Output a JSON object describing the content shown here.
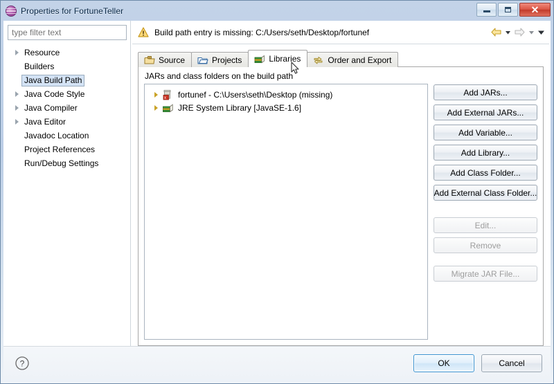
{
  "window": {
    "title": "Properties for FortuneTeller",
    "icon": "eclipse-sphere-icon",
    "controls": {
      "minimize": "minimize-button",
      "maximize": "maximize-button",
      "close": "close-button",
      "close_glyph": "✕"
    }
  },
  "sidebar": {
    "filter": {
      "placeholder": "type filter text",
      "value": ""
    },
    "items": [
      {
        "label": "Resource",
        "expandable": true,
        "selected": false
      },
      {
        "label": "Builders",
        "expandable": false,
        "selected": false
      },
      {
        "label": "Java Build Path",
        "expandable": false,
        "selected": true
      },
      {
        "label": "Java Code Style",
        "expandable": true,
        "selected": false
      },
      {
        "label": "Java Compiler",
        "expandable": true,
        "selected": false
      },
      {
        "label": "Java Editor",
        "expandable": true,
        "selected": false
      },
      {
        "label": "Javadoc Location",
        "expandable": false,
        "selected": false
      },
      {
        "label": "Project References",
        "expandable": false,
        "selected": false
      },
      {
        "label": "Run/Debug Settings",
        "expandable": false,
        "selected": false
      }
    ]
  },
  "message_bar": {
    "icon": "warning-icon",
    "text": "Build path entry is missing: C:/Users/seth/Desktop/fortunef",
    "nav": {
      "back": "back-arrow-icon",
      "back_dropdown": "chevron-down-icon",
      "forward": "forward-arrow-icon",
      "forward_dropdown": "chevron-down-icon",
      "menu_dropdown": "chevron-down-icon"
    }
  },
  "tabs": [
    {
      "label": "Source",
      "icon": "source-folder-icon",
      "active": false
    },
    {
      "label": "Projects",
      "icon": "project-folder-icon",
      "active": false
    },
    {
      "label": "Libraries",
      "icon": "library-books-icon",
      "active": true
    },
    {
      "label": "Order and Export",
      "icon": "order-export-icon",
      "active": false
    }
  ],
  "libraries_tab": {
    "caption": "JARs and class folders on the build path",
    "entries": [
      {
        "label": "fortunef - C:\\Users\\seth\\Desktop (missing)",
        "icon": "jar-error-icon",
        "expandable": true
      },
      {
        "label": "JRE System Library [JavaSE-1.6]",
        "icon": "library-books-icon",
        "expandable": true
      }
    ],
    "buttons": [
      {
        "label": "Add JARs...",
        "enabled": true
      },
      {
        "label": "Add External JARs...",
        "enabled": true
      },
      {
        "label": "Add Variable...",
        "enabled": true
      },
      {
        "label": "Add Library...",
        "enabled": true
      },
      {
        "label": "Add Class Folder...",
        "enabled": true
      },
      {
        "label": "Add External Class Folder...",
        "enabled": true
      },
      {
        "label": "Edit...",
        "enabled": false
      },
      {
        "label": "Remove",
        "enabled": false
      },
      {
        "label": "Migrate JAR File...",
        "enabled": false
      }
    ]
  },
  "footer": {
    "help_icon": "help-question-icon",
    "ok_label": "OK",
    "cancel_label": "Cancel"
  },
  "colors": {
    "accent_blue": "#3d94d1",
    "selection": "#d4e3f5",
    "warning": "#f0b41e",
    "error_red": "#cc3322"
  }
}
